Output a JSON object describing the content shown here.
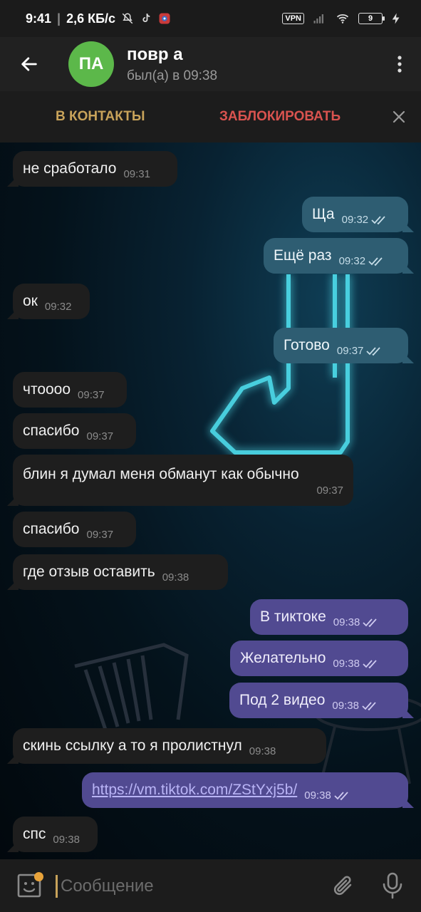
{
  "status_bar": {
    "time": "9:41",
    "network_speed": "2,6 КБ/с",
    "vpn": "VPN",
    "battery": "9"
  },
  "header": {
    "avatar_initials": "ПА",
    "name": "повр а",
    "last_seen": "был(а) в 09:38"
  },
  "action_bar": {
    "add_contact": "В КОНТАКТЫ",
    "block": "ЗАБЛОКИРОВАТЬ"
  },
  "messages": [
    {
      "text": "не сработало",
      "time": "09:31",
      "direction": "in"
    },
    {
      "text": "Ща",
      "time": "09:32",
      "direction": "out"
    },
    {
      "text": "Ещё раз",
      "time": "09:32",
      "direction": "out"
    },
    {
      "text": "ок",
      "time": "09:32",
      "direction": "in"
    },
    {
      "text": "Готово",
      "time": "09:37",
      "direction": "out"
    },
    {
      "text": "чтоооо",
      "time": "09:37",
      "direction": "in"
    },
    {
      "text": "спасибо",
      "time": "09:37",
      "direction": "in"
    },
    {
      "text": "блин я думал меня обманут как обычно",
      "time": "09:37",
      "direction": "in"
    },
    {
      "text": "спасибо",
      "time": "09:37",
      "direction": "in"
    },
    {
      "text": "где отзыв оставить",
      "time": "09:38",
      "direction": "in"
    },
    {
      "text": "В тиктоке",
      "time": "09:38",
      "direction": "out"
    },
    {
      "text": "Желательно",
      "time": "09:38",
      "direction": "out"
    },
    {
      "text": "Под 2 видео",
      "time": "09:38",
      "direction": "out"
    },
    {
      "text": "скинь ссылку а то я пролистнул",
      "time": "09:38",
      "direction": "in"
    },
    {
      "text": "https://vm.tiktok.com/ZStYxj5b/",
      "time": "09:38",
      "direction": "out"
    },
    {
      "text": "спс",
      "time": "09:38",
      "direction": "in"
    }
  ],
  "input": {
    "placeholder": "Сообщение"
  },
  "colors": {
    "incoming_bubble": "#1e1e1e",
    "outgoing_teal": "#2e5d72",
    "outgoing_violet": "#514a91",
    "add_contact": "#c8a35a",
    "block": "#d9534f",
    "avatar": "#5cb84a"
  },
  "icons": {
    "back": "arrow-left-icon",
    "menu": "more-vertical-icon",
    "close": "close-icon",
    "emoji": "sticker-icon",
    "attach": "paperclip-icon",
    "mic": "microphone-icon",
    "read": "double-check-icon"
  }
}
